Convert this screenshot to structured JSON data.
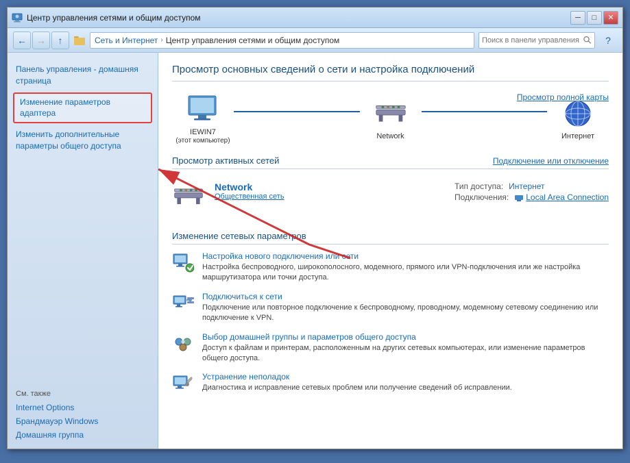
{
  "window": {
    "title": "Центр управления сетями и общим доступом",
    "minimize_label": "─",
    "maximize_label": "□",
    "close_label": "✕"
  },
  "addressbar": {
    "back_tooltip": "Назад",
    "forward_tooltip": "Вперёд",
    "breadcrumb": [
      {
        "label": "Сеть и Интернет",
        "sep": "›"
      },
      {
        "label": "Центр управления сетями и общим доступом",
        "sep": ""
      }
    ],
    "search_placeholder": "Поиск в панели управления",
    "refresh_icon": "⟳",
    "help_icon": "?"
  },
  "sidebar": {
    "home_label": "Панель управления - домашняя страница",
    "adapter_label": "Изменение параметров адаптера",
    "share_label": "Изменить дополнительные параметры общего доступа",
    "see_also_title": "См. также",
    "links": [
      {
        "label": "Internet Options"
      },
      {
        "label": "Брандмауэр Windows"
      },
      {
        "label": "Домашняя группа"
      }
    ]
  },
  "main": {
    "page_title": "Просмотр основных сведений о сети и настройка подключений",
    "view_full_map": "Просмотр полной карты",
    "network_nodes": [
      {
        "label": "IEWIN7\n(этот компьютер)",
        "type": "computer"
      },
      {
        "label": "Network",
        "type": "bench"
      },
      {
        "label": "Интернет",
        "type": "internet"
      }
    ],
    "active_networks_title": "Просмотр активных сетей",
    "connect_disconnect": "Подключение или отключение",
    "active_network": {
      "name": "Network",
      "type": "Общественная сеть",
      "access_type_label": "Тип доступа:",
      "access_type_value": "Интернет",
      "connections_label": "Подключения:",
      "connections_value": "Local Area Connection"
    },
    "change_section_title": "Изменение сетевых параметров",
    "change_items": [
      {
        "title": "Настройка нового подключения или сети",
        "desc": "Настройка беспроводного, широкополосного, модемного, прямого или VPN-подключения или же настройка маршрутизатора или точки доступа.",
        "icon": "network-setup"
      },
      {
        "title": "Подключиться к сети",
        "desc": "Подключение или повторное подключение к беспроводному, проводному, модемному сетевому соединению или подключение к VPN.",
        "icon": "network-connect"
      },
      {
        "title": "Выбор домашней группы и параметров общего доступа",
        "desc": "Доступ к файлам и принтерам, расположенным на других сетевых компьютерах, или изменение параметров общего доступа.",
        "icon": "homegroup"
      },
      {
        "title": "Устранение неполадок",
        "desc": "Диагностика и исправление сетевых проблем или получение сведений об исправлении.",
        "icon": "troubleshoot"
      }
    ]
  },
  "colors": {
    "accent": "#1a6bb5",
    "sidebar_bg": "#dce8f5",
    "title_color": "#1a5080",
    "link_color": "#1a6bb5",
    "border": "#c0d0e0"
  }
}
